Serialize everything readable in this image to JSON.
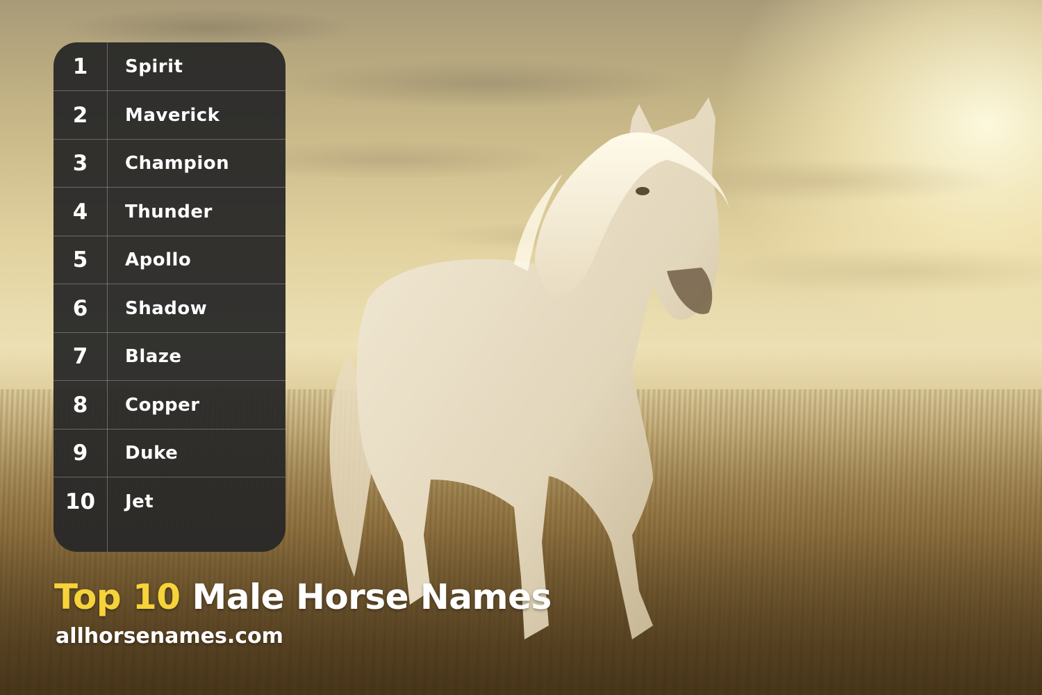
{
  "title": {
    "accent": "Top 10",
    "rest": "Male Horse Names"
  },
  "website": "allhorsenames.com",
  "colors": {
    "accent": "#f7d33a",
    "panel": "#282828",
    "text": "#ffffff"
  },
  "names": [
    {
      "rank": "1",
      "name": "Spirit"
    },
    {
      "rank": "2",
      "name": "Maverick"
    },
    {
      "rank": "3",
      "name": "Champion"
    },
    {
      "rank": "4",
      "name": "Thunder"
    },
    {
      "rank": "5",
      "name": "Apollo"
    },
    {
      "rank": "6",
      "name": "Shadow"
    },
    {
      "rank": "7",
      "name": "Blaze"
    },
    {
      "rank": "8",
      "name": "Copper"
    },
    {
      "rank": "9",
      "name": "Duke"
    },
    {
      "rank": "10",
      "name": "Jet"
    }
  ]
}
